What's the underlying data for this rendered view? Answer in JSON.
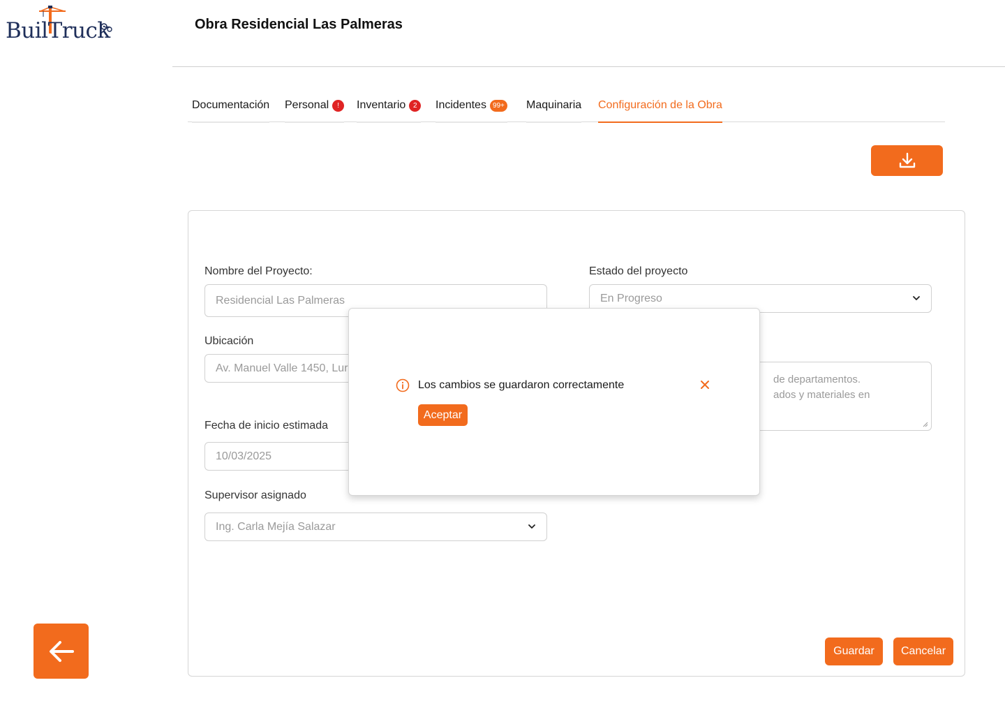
{
  "brand": {
    "logo_text": "BuilTruck",
    "accent_color": "#f26b1d",
    "navy_color": "#1f2f5a"
  },
  "header": {
    "title": "Obra Residencial Las Palmeras"
  },
  "tabs": [
    {
      "label": "Documentación"
    },
    {
      "label": "Personal",
      "badge": "!"
    },
    {
      "label": "Inventario",
      "badge": "2"
    },
    {
      "label": "Incidentes",
      "badge": "99+"
    },
    {
      "label": "Maquinaria"
    },
    {
      "label": "Configuración de la Obra",
      "active": true
    }
  ],
  "toolbar": {
    "download_icon": "download-icon"
  },
  "form": {
    "project_name": {
      "label": "Nombre del Proyecto:",
      "value": "Residencial Las Palmeras"
    },
    "status": {
      "label": "Estado del proyecto",
      "value": "En Progreso"
    },
    "location": {
      "label": "Ubicación",
      "value": "Av. Manuel Valle 1450, Lur"
    },
    "description": {
      "line1": "de departamentos.",
      "line2": "ados y materiales en"
    },
    "start_date": {
      "label": "Fecha de inicio estimada",
      "value": "10/03/2025"
    },
    "supervisor": {
      "label": "Supervisor asignado",
      "value": "Ing. Carla Mejía Salazar"
    },
    "save_label": "Guardar",
    "cancel_label": "Cancelar"
  },
  "modal": {
    "message": "Los cambios se guardaron correctamente",
    "accept_label": "Aceptar"
  },
  "back_icon": "arrow-left-icon"
}
